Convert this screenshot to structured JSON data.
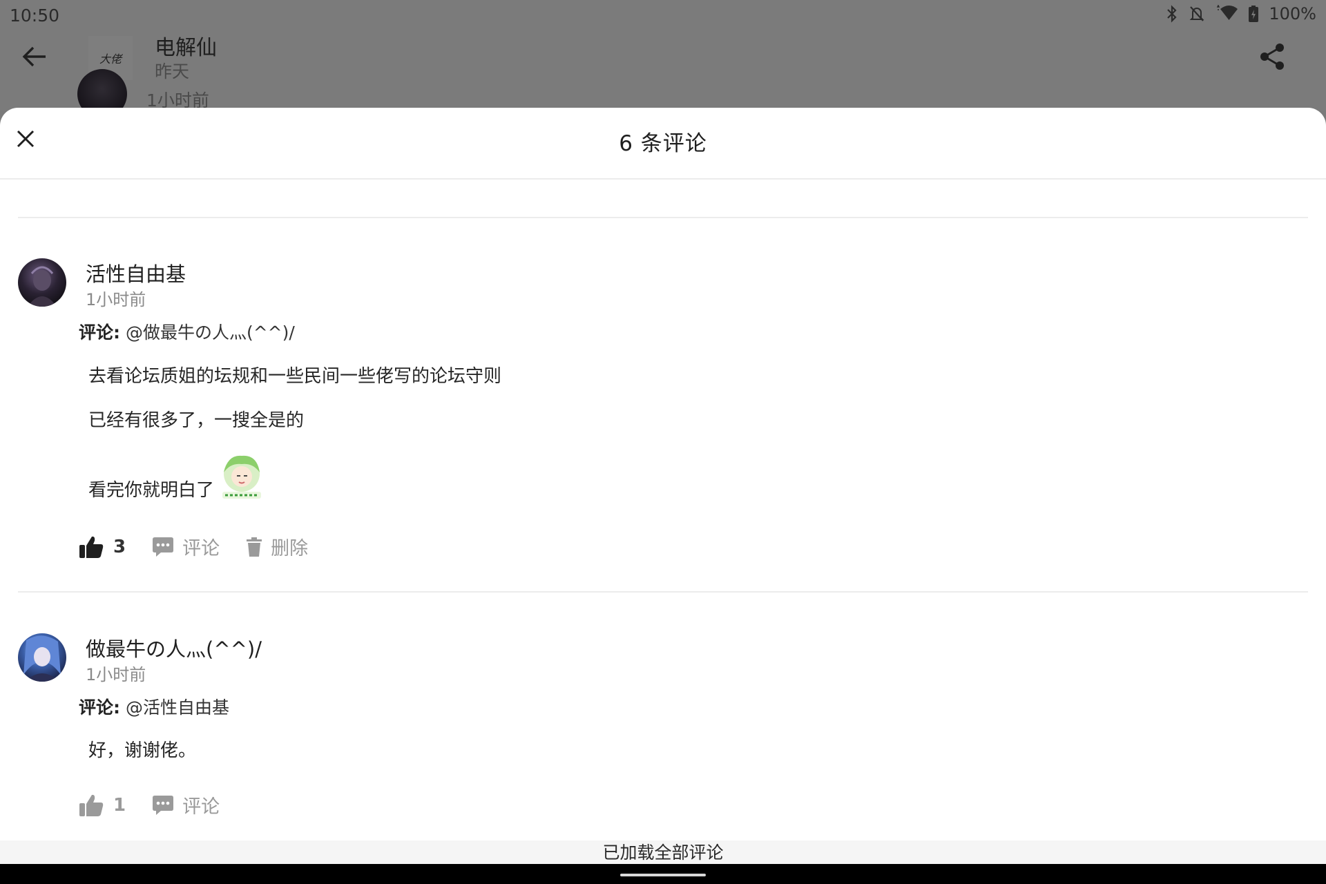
{
  "status_bar": {
    "time": "10:50",
    "battery": "100%",
    "icons": [
      "bluetooth-icon",
      "notifications-off-icon",
      "wifi-icon",
      "battery-charging-icon"
    ]
  },
  "article_header": {
    "author_name": "电解仙",
    "author_date": "昨天",
    "logo_text": "大佬",
    "underlying_comment_time": "1小时前"
  },
  "sheet": {
    "title": "6 条评论",
    "close_icon": "close-icon"
  },
  "comments": [
    {
      "user": "活性自由基",
      "time": "1小时前",
      "reply_label": "评论:",
      "reply_target": "@做最牛の人灬(^^)/",
      "lines": [
        "去看论坛质姐的坛规和一些民间一些佬写的论坛守则",
        "已经有很多了，一搜全是的",
        "看完你就明白了"
      ],
      "likes": "3",
      "liked": true,
      "comment_label": "评论",
      "delete_label": "删除"
    },
    {
      "user": "做最牛の人灬(^^)/",
      "time": "1小时前",
      "reply_label": "评论:",
      "reply_target": "@活性自由基",
      "lines": [
        "好，谢谢佬。"
      ],
      "likes": "1",
      "liked": false,
      "comment_label": "评论"
    }
  ],
  "footer": {
    "loaded_all": "已加载全部评论"
  },
  "colors": {
    "dim_overlay": "#7b7b7b",
    "sheet_bg": "#ffffff",
    "muted_text": "#8a8a8a",
    "action_gray": "#9a9a9a"
  }
}
